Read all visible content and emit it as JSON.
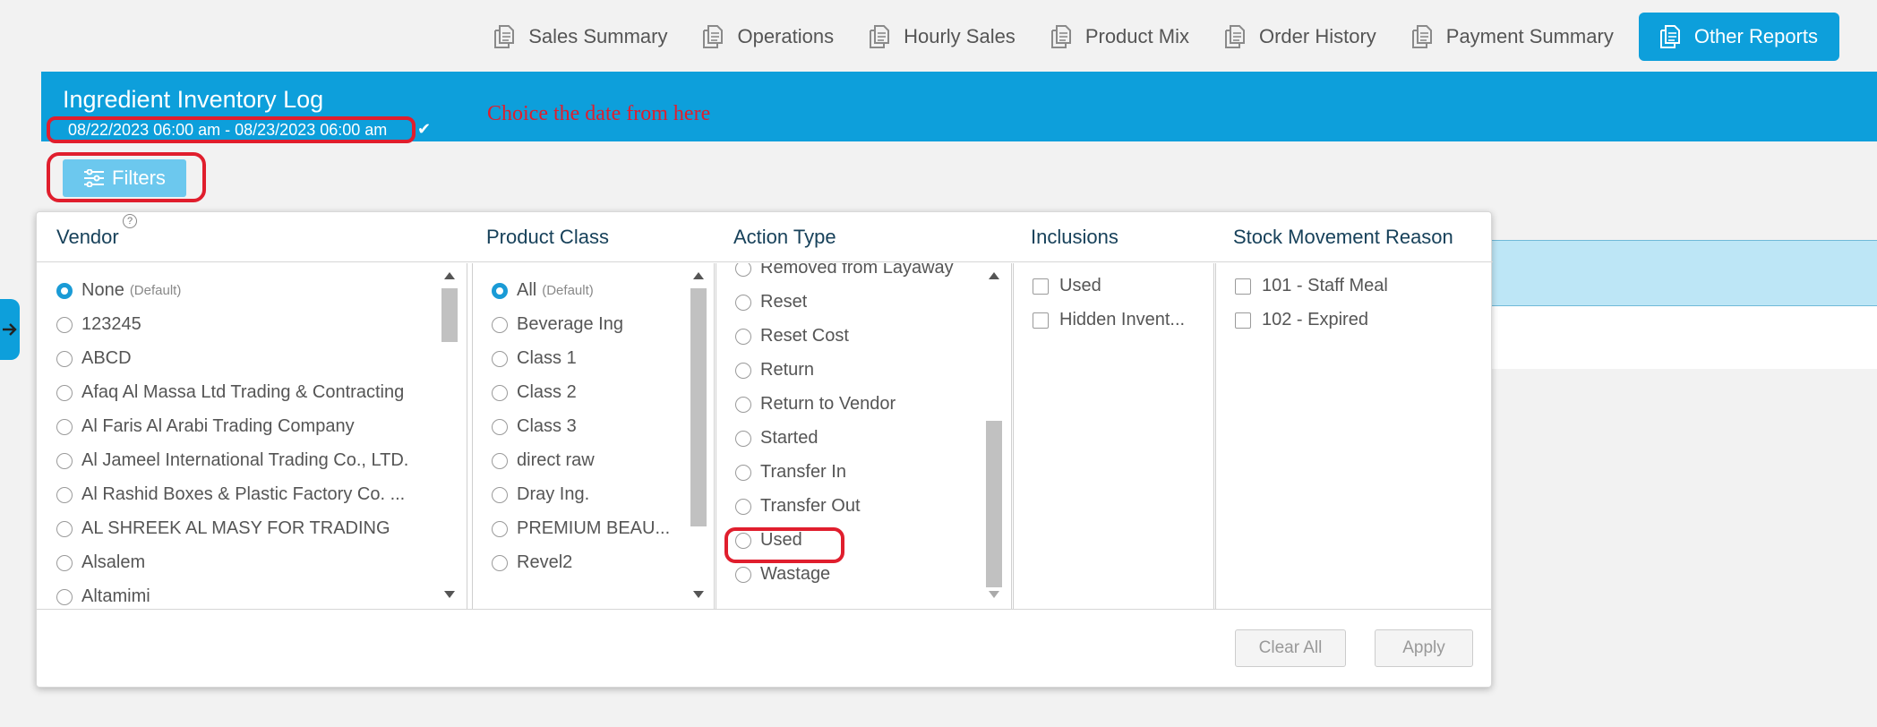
{
  "nav": {
    "tabs": [
      {
        "label": "Sales Summary",
        "icon": "document-copy-icon"
      },
      {
        "label": "Operations",
        "icon": "document-copy-icon"
      },
      {
        "label": "Hourly Sales",
        "icon": "document-copy-icon"
      },
      {
        "label": "Product Mix",
        "icon": "document-copy-icon"
      },
      {
        "label": "Order History",
        "icon": "document-copy-icon"
      },
      {
        "label": "Payment Summary",
        "icon": "document-copy-icon"
      },
      {
        "label": "Other Reports",
        "icon": "document-copy-icon",
        "active": true
      }
    ]
  },
  "report": {
    "title": "Ingredient Inventory Log",
    "date_range": "08/22/2023 06:00 am - 08/23/2023 06:00 am",
    "annotation": "Choice the date from here"
  },
  "filters_button": {
    "label": "Filters",
    "icon": "sliders-icon"
  },
  "filter_panel": {
    "columns": {
      "vendor": "Vendor",
      "product_class": "Product Class",
      "action_type": "Action Type",
      "inclusions": "Inclusions",
      "stock_movement_reason": "Stock Movement Reason"
    },
    "vendor_options": [
      {
        "label": "None",
        "tag": "(Default)",
        "selected": true
      },
      {
        "label": "123245"
      },
      {
        "label": "ABCD"
      },
      {
        "label": "Afaq Al Massa Ltd Trading & Contracting"
      },
      {
        "label": "Al Faris Al Arabi Trading Company"
      },
      {
        "label": "Al Jameel International Trading Co., LTD."
      },
      {
        "label": "Al Rashid Boxes & Plastic Factory Co. ..."
      },
      {
        "label": "AL SHREEK AL MASY FOR TRADING"
      },
      {
        "label": "Alsalem"
      },
      {
        "label": "Altamimi"
      }
    ],
    "product_class_options": [
      {
        "label": "All",
        "tag": "(Default)",
        "selected": true
      },
      {
        "label": "Beverage Ing"
      },
      {
        "label": "Class 1"
      },
      {
        "label": "Class 2"
      },
      {
        "label": "Class 3"
      },
      {
        "label": "direct raw"
      },
      {
        "label": "Dray Ing."
      },
      {
        "label": "PREMIUM BEAU..."
      },
      {
        "label": "Revel2"
      }
    ],
    "action_type_options": [
      {
        "label": "Removed from Layaway"
      },
      {
        "label": "Reset"
      },
      {
        "label": "Reset Cost"
      },
      {
        "label": "Return"
      },
      {
        "label": "Return to Vendor"
      },
      {
        "label": "Started"
      },
      {
        "label": "Transfer In"
      },
      {
        "label": "Transfer Out"
      },
      {
        "label": "Used",
        "highlighted": true
      },
      {
        "label": "Wastage"
      }
    ],
    "inclusion_options": [
      {
        "label": "Used",
        "checked": false
      },
      {
        "label": "Hidden Invent...",
        "checked": false
      }
    ],
    "stock_reason_options": [
      {
        "label": "101 - Staff Meal",
        "checked": false
      },
      {
        "label": "102 - Expired",
        "checked": false
      }
    ],
    "clear_all_label": "Clear All",
    "apply_label": "Apply"
  },
  "colors": {
    "accent": "#0d9fdb",
    "annotation_red": "#e01e2d",
    "filters_button": "#6cc8ee"
  }
}
